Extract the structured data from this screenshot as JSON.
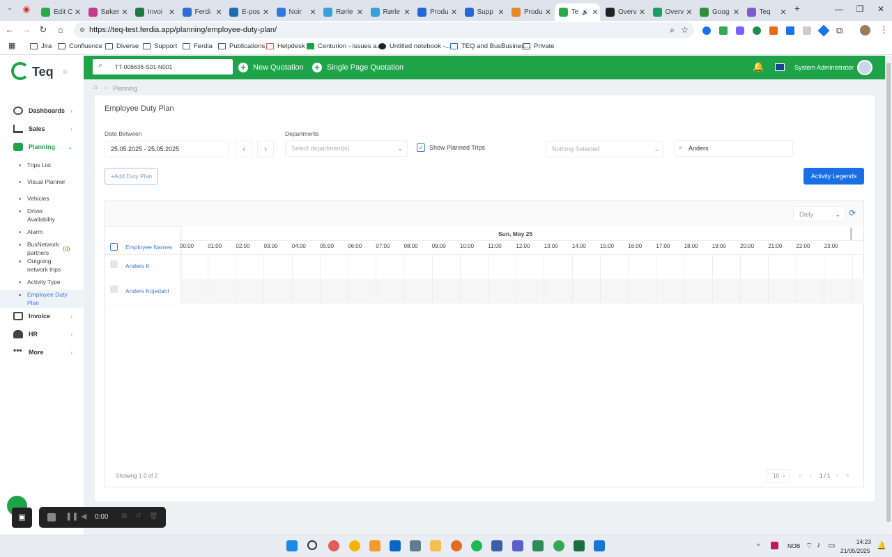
{
  "browser": {
    "tabs": [
      {
        "label": "Edit C",
        "color": "#2aa84a"
      },
      {
        "label": "Søker",
        "color": "#c23b8c"
      },
      {
        "label": "Invoi",
        "color": "#1e7a40"
      },
      {
        "label": "Ferdi",
        "color": "#2c6fd1"
      },
      {
        "label": "E-pos",
        "color": "#1f6bb3"
      },
      {
        "label": "Noir",
        "color": "#2f7ae0"
      },
      {
        "label": "Rørle",
        "color": "#3aa0d9"
      },
      {
        "label": "Rørle",
        "color": "#3aa0d9"
      },
      {
        "label": "Produ",
        "color": "#2468d8"
      },
      {
        "label": "Supp",
        "color": "#2468d8"
      },
      {
        "label": "Produ",
        "color": "#e4892a"
      },
      {
        "label": "Te",
        "color": "#2aa84a",
        "active": true
      },
      {
        "label": "Overv",
        "color": "#222"
      },
      {
        "label": "Overv",
        "color": "#1c9e63"
      },
      {
        "label": "Goog",
        "color": "#2d8f3a"
      },
      {
        "label": "Teq",
        "color": "#7b5bd6"
      }
    ],
    "url": "https://teq-test.ferdia.app/planning/employee-duty-plan/",
    "bookmarks": [
      "Jira",
      "Confluence",
      "Diverse",
      "Support",
      "Ferdia",
      "Publications",
      "Helpdesk",
      "Centurion - issues a...",
      "Untitled notebook -...",
      "TEQ and BusBusines...",
      "Private"
    ]
  },
  "app": {
    "logo_text": "Teq",
    "search_value": "TT-006636-S01-N001",
    "new_quotation": "New Quotation",
    "single_page_quotation": "Single Page Quotation",
    "user_name": "System Administrator",
    "brand_color": "#1ea34a"
  },
  "sidebar": {
    "dashboards": "Dashboards",
    "sales": "Sales",
    "planning": "Planning",
    "sub_items": [
      {
        "label": "Trips List"
      },
      {
        "label": "Visual Planner"
      },
      {
        "label": "Vehicles"
      },
      {
        "label": "Driver Availability"
      },
      {
        "label": "Alarm"
      },
      {
        "label": "BusNetwork partners",
        "badge": "(0)"
      },
      {
        "label": "Outgoing network trips"
      },
      {
        "label": "Activity Type"
      },
      {
        "label": "Employee Duty Plan",
        "active": true
      }
    ],
    "invoice": "Invoice",
    "hr": "HR",
    "more": "More"
  },
  "breadcrumb": {
    "item": "Planning"
  },
  "page": {
    "title": "Employee Duty Plan",
    "date_label": "Date Between",
    "date_value": "25.05.2025 - 25.05.2025",
    "departments_label": "Departments",
    "departments_placeholder": "Select department(s)",
    "show_planned_trips": "Show Planned Trips",
    "nothing_selected": "Nothing Selected",
    "search_value": "Anders",
    "add_duty_plan": "+Add Duty Plan",
    "activity_legends": "Activity Legends",
    "view_mode": "Daily",
    "day_header": "Sun, May 25",
    "employee_names_header": "Employee Names",
    "hours": [
      "00:00",
      "01:00",
      "02:00",
      "03:00",
      "04:00",
      "05:00",
      "06:00",
      "07:00",
      "08:00",
      "09:00",
      "10:00",
      "11:00",
      "12:00",
      "13:00",
      "14:00",
      "15:00",
      "16:00",
      "17:00",
      "18:00",
      "19:00",
      "20:00",
      "21:00",
      "22:00",
      "23:00"
    ],
    "employees": [
      "Anders K",
      "Anders Kojedahl"
    ],
    "showing": "Showing 1-2 of 2",
    "page_size": "10",
    "pagination": "1 / 1"
  },
  "recorder": {
    "time": "0:00"
  },
  "taskbar": {
    "language": "NOB",
    "time": "14:23",
    "date": "21/05/2025"
  }
}
